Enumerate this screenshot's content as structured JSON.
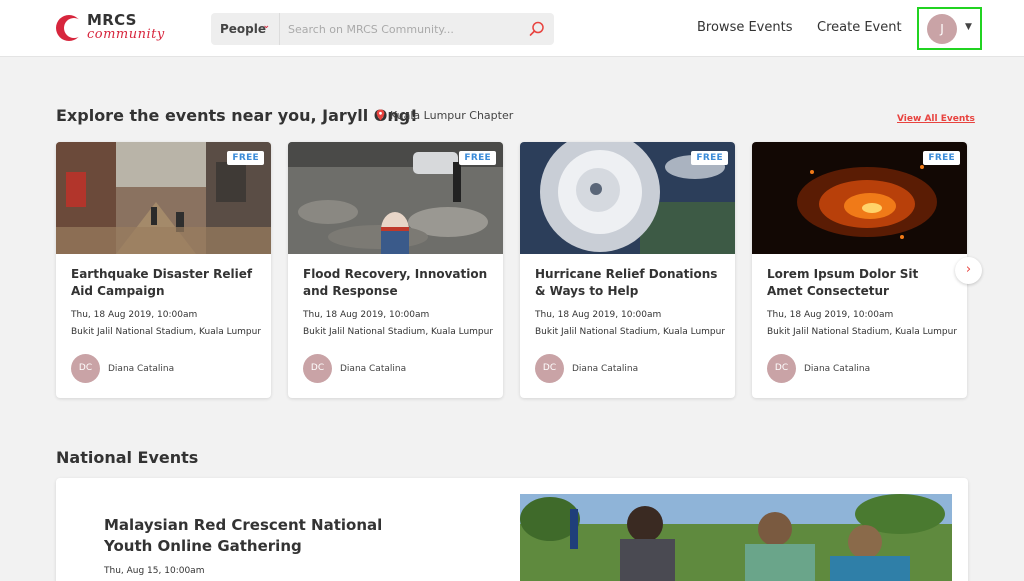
{
  "header": {
    "logo_line1": "MRCS",
    "logo_line2": "community",
    "search_scope": "People",
    "search_placeholder": "Search on MRCS Community...",
    "nav": {
      "browse": "Browse Events",
      "create": "Create Event"
    },
    "user_initial": "J"
  },
  "explore": {
    "title": "Explore the events near you, Jaryll Ong!",
    "chapter": "Kuala Lumpur Chapter",
    "view_all": "View All Events",
    "cards": [
      {
        "badge": "FREE",
        "title": "Earthquake Disaster Relief Aid Campaign",
        "date": "Thu, 18 Aug 2019, 10:00am",
        "venue": "Bukit Jalil National Stadium, Kuala Lumpur",
        "organizer_initials": "DC",
        "organizer": "Diana Catalina"
      },
      {
        "badge": "FREE",
        "title": "Flood Recovery, Innovation and Response",
        "date": "Thu, 18 Aug 2019, 10:00am",
        "venue": "Bukit Jalil National Stadium, Kuala Lumpur",
        "organizer_initials": "DC",
        "organizer": "Diana Catalina"
      },
      {
        "badge": "FREE",
        "title": "Hurricane Relief Donations & Ways to Help",
        "date": "Thu, 18 Aug 2019, 10:00am",
        "venue": "Bukit Jalil National Stadium, Kuala Lumpur",
        "organizer_initials": "DC",
        "organizer": "Diana Catalina"
      },
      {
        "badge": "FREE",
        "title": "Lorem Ipsum Dolor Sit Amet Consectetur Adipiscing Elit…",
        "date": "Thu, 18 Aug 2019, 10:00am",
        "venue": "Bukit Jalil National Stadium, Kuala Lumpur",
        "organizer_initials": "DC",
        "organizer": "Diana Catalina"
      }
    ]
  },
  "national": {
    "title": "National Events",
    "event_title": "Malaysian Red Crescent National Youth Online Gathering",
    "event_date": "Thu, Aug 15, 10:00am"
  },
  "icons": {
    "search": "search-icon",
    "pin": "map-pin-icon",
    "next": "chevron-right-icon"
  },
  "colors": {
    "brand_red": "#d7263d",
    "link_red": "#e8433f",
    "badge_blue": "#3b8bd8",
    "highlight_green": "#21d321"
  }
}
